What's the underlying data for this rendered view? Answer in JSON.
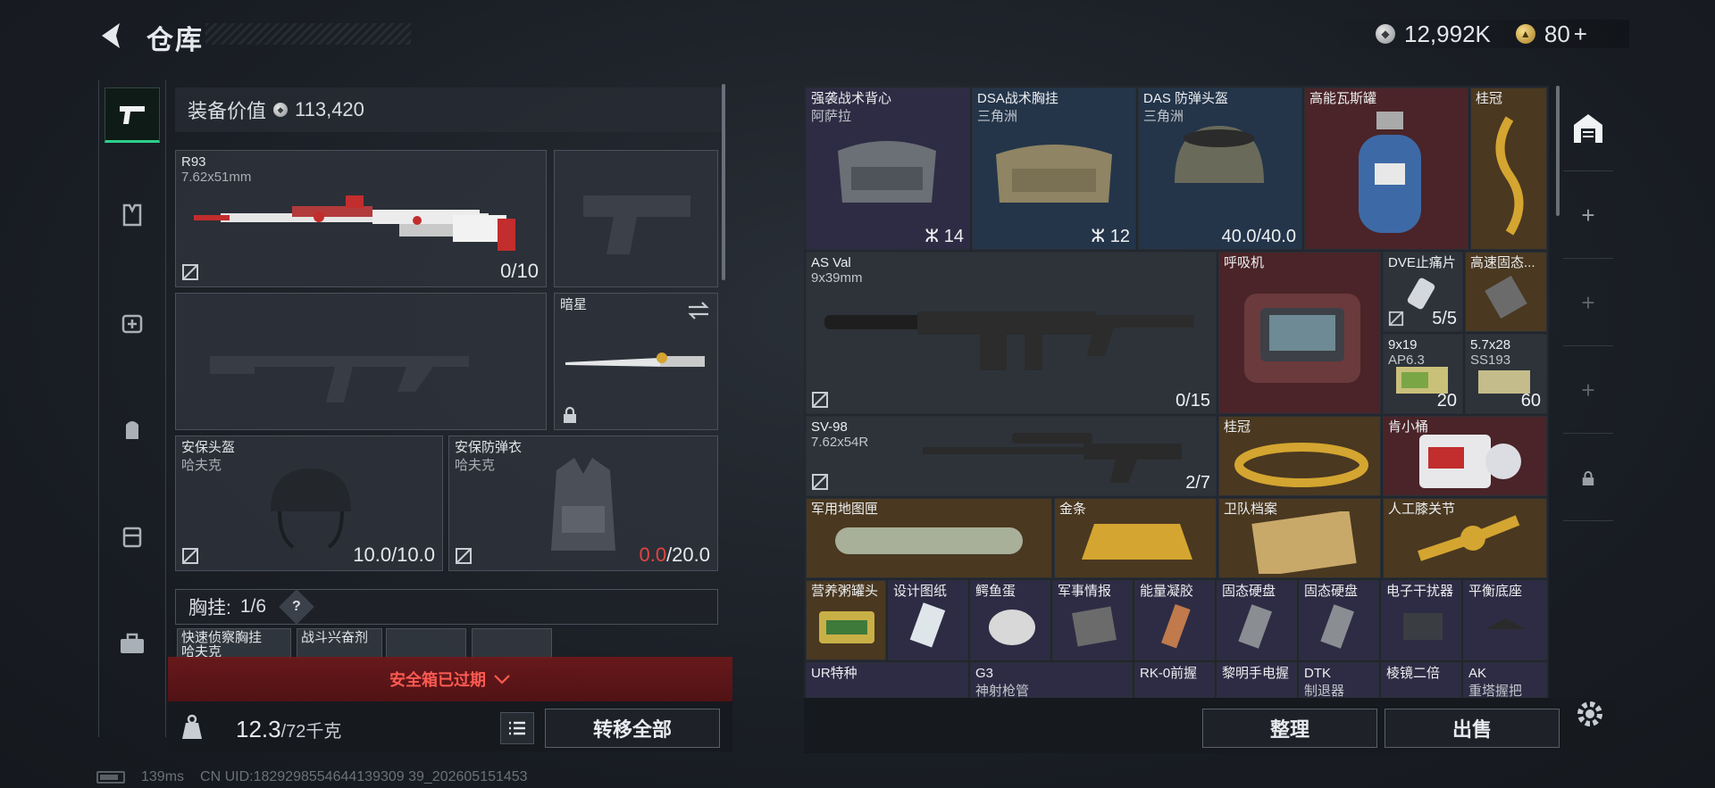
{
  "header": {
    "title": "仓库",
    "silver_amount": "12,992K",
    "gold_amount": "80"
  },
  "loadout": {
    "value_label": "装备价值",
    "value": "113,420",
    "primary": {
      "name": "R93",
      "caliber": "7.62x51mm",
      "ammo": "0/10"
    },
    "melee": {
      "name": "暗星"
    },
    "helmet": {
      "name": "安保头盔",
      "map": "哈夫克",
      "durability": "10.0/10.0"
    },
    "armor": {
      "name": "安保防弹衣",
      "map": "哈夫克",
      "durability_current": "0.0",
      "durability_max": "/20.0"
    },
    "rig": {
      "label": "胸挂:",
      "count": "1/6",
      "help": "?"
    },
    "rig_items": [
      {
        "name": "快速侦察胸挂",
        "sub": "哈夫克"
      },
      {
        "name": "战斗兴奋剂",
        "sub": ""
      }
    ],
    "safe_box": "安全箱已过期",
    "weight": "12.3",
    "weight_max": "/72千克",
    "transfer_all": "转移全部"
  },
  "storage": {
    "items": [
      {
        "name": "强袭战术背心",
        "sub": "阿萨拉",
        "count": "14"
      },
      {
        "name": "DSA战术胸挂",
        "sub": "三角洲",
        "count": "12"
      },
      {
        "name": "DAS 防弹头盔",
        "sub": "三角洲",
        "count": "40.0/40.0"
      },
      {
        "name": "高能瓦斯罐",
        "sub": "",
        "count": ""
      },
      {
        "name": "桂冠",
        "sub": "",
        "count": ""
      },
      {
        "name": "AS Val",
        "sub": "9x39mm",
        "count": "0/15"
      },
      {
        "name": "呼吸机",
        "sub": "",
        "count": ""
      },
      {
        "name": "DVE止痛片",
        "sub": "",
        "count": "5/5"
      },
      {
        "name": "高速固态...",
        "sub": "",
        "count": ""
      },
      {
        "name": "9x19",
        "sub": "AP6.3",
        "count": "20"
      },
      {
        "name": "5.7x28",
        "sub": "SS193",
        "count": "60"
      },
      {
        "name": "SV-98",
        "sub": "7.62x54R",
        "count": "2/7"
      },
      {
        "name": "桂冠",
        "sub": "",
        "count": ""
      },
      {
        "name": "肯小桶",
        "sub": "",
        "count": ""
      },
      {
        "name": "军用地图匣",
        "sub": "",
        "count": ""
      },
      {
        "name": "金条",
        "sub": "",
        "count": ""
      },
      {
        "name": "卫队档案",
        "sub": "",
        "count": ""
      },
      {
        "name": "人工膝关节",
        "sub": "",
        "count": ""
      },
      {
        "name": "营养粥罐头",
        "sub": "",
        "count": ""
      },
      {
        "name": "设计图纸",
        "sub": "",
        "count": ""
      },
      {
        "name": "鳄鱼蛋",
        "sub": "",
        "count": ""
      },
      {
        "name": "军事情报",
        "sub": "",
        "count": ""
      },
      {
        "name": "能量凝胶",
        "sub": "",
        "count": ""
      },
      {
        "name": "固态硬盘",
        "sub": "",
        "count": ""
      },
      {
        "name": "固态硬盘",
        "sub": "",
        "count": ""
      },
      {
        "name": "电子干扰器",
        "sub": "",
        "count": ""
      },
      {
        "name": "平衡底座",
        "sub": "",
        "count": ""
      },
      {
        "name": "UR特种",
        "sub": "",
        "count": ""
      },
      {
        "name": "G3",
        "sub": "神射枪管",
        "count": ""
      },
      {
        "name": "RK-0前握",
        "sub": "",
        "count": ""
      },
      {
        "name": "黎明手电握",
        "sub": "",
        "count": ""
      },
      {
        "name": "DTK",
        "sub": "制退器",
        "count": ""
      },
      {
        "name": "棱镜二倍",
        "sub": "",
        "count": ""
      },
      {
        "name": "AK",
        "sub": "重塔握把",
        "count": ""
      }
    ],
    "sort": "整理",
    "sell": "出售"
  },
  "status": {
    "ping": "139ms",
    "uid": "CN UID:1829298554644139309 39_202605151453"
  }
}
